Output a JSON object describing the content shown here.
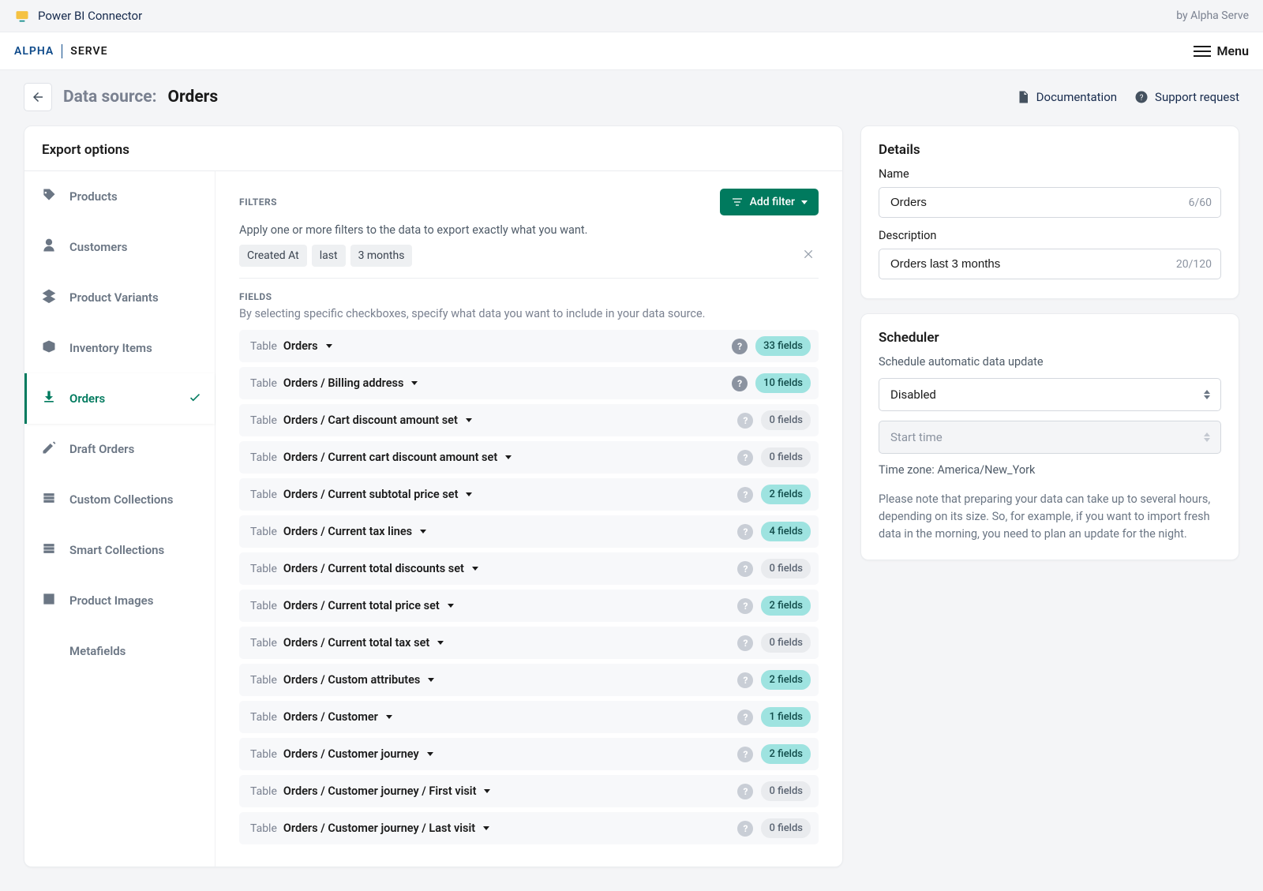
{
  "topbar": {
    "product_name": "Power BI Connector",
    "by_line": "by Alpha Serve"
  },
  "appheader": {
    "logo_left": "ALPHA",
    "logo_right": "SERVE",
    "menu_label": "Menu"
  },
  "subheader": {
    "ds_label": "Data source:",
    "ds_name": "Orders",
    "doc_label": "Documentation",
    "support_label": "Support request"
  },
  "export": {
    "title": "Export options",
    "sidebar_items": [
      {
        "label": "Products",
        "icon": "tag"
      },
      {
        "label": "Customers",
        "icon": "person"
      },
      {
        "label": "Product Variants",
        "icon": "layers"
      },
      {
        "label": "Inventory Items",
        "icon": "box"
      },
      {
        "label": "Orders",
        "icon": "download"
      },
      {
        "label": "Draft Orders",
        "icon": "edit"
      },
      {
        "label": "Custom Collections",
        "icon": "stack"
      },
      {
        "label": "Smart Collections",
        "icon": "stack"
      },
      {
        "label": "Product Images",
        "icon": "image"
      },
      {
        "label": "Metafields",
        "icon": "hash"
      }
    ],
    "active_sidebar_index": 4,
    "filters_label": "FILTERS",
    "add_filter_label": "Add filter",
    "filters_desc": "Apply one or more filters to the data to export exactly what you want.",
    "filter_chips": [
      "Created At",
      "last",
      "3 months"
    ],
    "fields_label": "FIELDS",
    "fields_desc": "By selecting specific checkboxes, specify what data you want to include in your data source.",
    "table_tag": "Table",
    "tables": [
      {
        "name": "Orders",
        "count": "33 fields",
        "style": "teal",
        "dark": true
      },
      {
        "name": "Orders / Billing address",
        "count": "10 fields",
        "style": "teal",
        "dark": true
      },
      {
        "name": "Orders / Cart discount amount set",
        "count": "0 fields",
        "style": "gray"
      },
      {
        "name": "Orders / Current cart discount amount set",
        "count": "0 fields",
        "style": "gray"
      },
      {
        "name": "Orders / Current subtotal price set",
        "count": "2 fields",
        "style": "teal"
      },
      {
        "name": "Orders / Current tax lines",
        "count": "4 fields",
        "style": "teal"
      },
      {
        "name": "Orders / Current total discounts set",
        "count": "0 fields",
        "style": "gray"
      },
      {
        "name": "Orders / Current total price set",
        "count": "2 fields",
        "style": "teal"
      },
      {
        "name": "Orders / Current total tax set",
        "count": "0 fields",
        "style": "gray"
      },
      {
        "name": "Orders / Custom attributes",
        "count": "2 fields",
        "style": "teal"
      },
      {
        "name": "Orders / Customer",
        "count": "1 fields",
        "style": "teal"
      },
      {
        "name": "Orders / Customer journey",
        "count": "2 fields",
        "style": "teal"
      },
      {
        "name": "Orders / Customer journey / First visit",
        "count": "0 fields",
        "style": "gray"
      },
      {
        "name": "Orders / Customer journey / Last visit",
        "count": "0 fields",
        "style": "gray"
      }
    ]
  },
  "details": {
    "title": "Details",
    "name_label": "Name",
    "name_value": "Orders",
    "name_counter": "6/60",
    "desc_label": "Description",
    "desc_value": "Orders last 3 months",
    "desc_counter": "20/120"
  },
  "scheduler": {
    "title": "Scheduler",
    "desc": "Schedule automatic data update",
    "status_value": "Disabled",
    "start_placeholder": "Start time",
    "tz_label": "Time zone: America/New_York",
    "note": "Please note that preparing your data can take up to several hours, depending on its size. So, for example, if you want to import fresh data in the morning, you need to plan an update for the night."
  }
}
